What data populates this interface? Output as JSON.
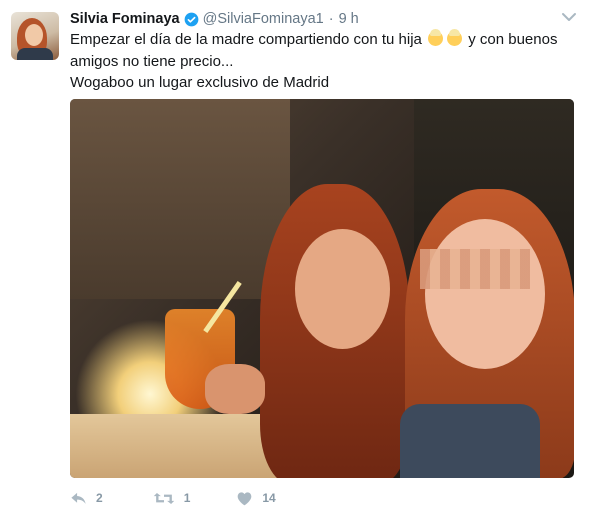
{
  "tweet": {
    "author_name": "Silvia Fominaya",
    "handle": "@SilviaFominaya1",
    "separator": "·",
    "time": "9 h",
    "text_line1_a": "Empezar el día de la madre compartiendo con tu hija",
    "text_line1_b": "y con buenos",
    "text_line2": "amigos no tiene precio...",
    "text_line3": "Wogaboo un lugar exclusivo de Madrid",
    "emoji_names": [
      "person-blond-emoji",
      "older-person-emoji"
    ]
  },
  "actions": {
    "reply_count": "2",
    "retweet_count": "1",
    "like_count": "14"
  },
  "colors": {
    "name": "#14171a",
    "meta": "#657786",
    "action": "#8899a6",
    "verified": "#1da1f2"
  },
  "icons": {
    "verified": "verified-badge-icon",
    "menu": "chevron-down-icon",
    "reply": "reply-icon",
    "retweet": "retweet-icon",
    "like": "heart-icon"
  }
}
